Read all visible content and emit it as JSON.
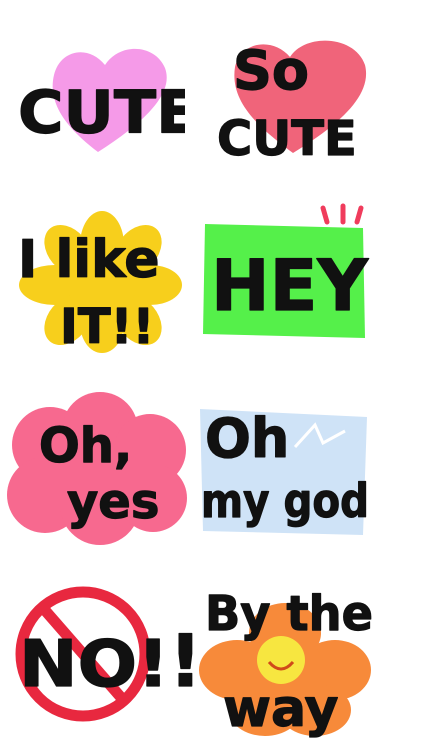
{
  "stickers": [
    {
      "id": "cute",
      "lines": [
        "CUTE"
      ],
      "shape": "heart",
      "color": "#f59ae8"
    },
    {
      "id": "so-cute",
      "lines": [
        "So",
        "CUTE"
      ],
      "shape": "heart",
      "color": "#f0647a"
    },
    {
      "id": "i-like-it",
      "lines": [
        "I like",
        "IT!!"
      ],
      "shape": "flower",
      "color": "#f7cf1c"
    },
    {
      "id": "hey",
      "lines": [
        "HEY"
      ],
      "shape": "rectangle",
      "color": "#55f04a",
      "accent": "#f03c5c"
    },
    {
      "id": "oh-yes",
      "lines": [
        "Oh,",
        "yes"
      ],
      "shape": "cloud",
      "color": "#f7698f"
    },
    {
      "id": "oh-my-god",
      "lines": [
        "Oh",
        "my god"
      ],
      "shape": "rectangle",
      "color": "#cfe3f7"
    },
    {
      "id": "no",
      "lines": [
        "NO!",
        "!"
      ],
      "shape": "prohibition-sign",
      "color": "#e8283f"
    },
    {
      "id": "by-the-way",
      "lines": [
        "By the",
        "way"
      ],
      "shape": "flower",
      "color": "#f78a3a",
      "accent": "#f7e640"
    }
  ]
}
